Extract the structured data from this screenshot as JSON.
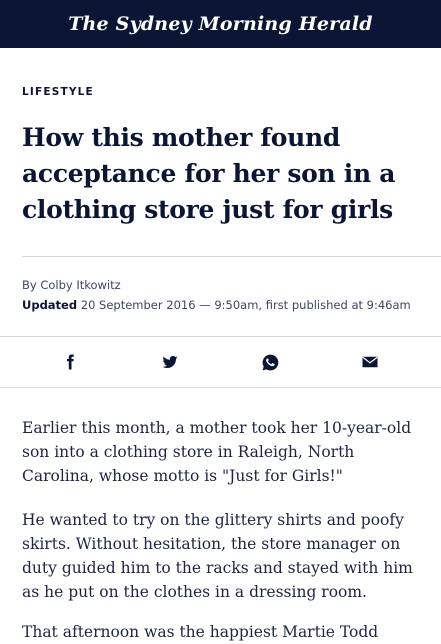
{
  "masthead": {
    "title": "The Sydney Morning Herald"
  },
  "article": {
    "section": "LIFESTYLE",
    "headline": "How this mother found acceptance for her son in a clothing store just for girls",
    "byline": "By Colby Itkowitz",
    "updated_label": "Updated",
    "updated_text": "20 September 2016 — 9:50am, first published at 9:46am",
    "paragraphs": [
      "Earlier this month, a mother took her 10-year-old son into a clothing store in Raleigh, North Carolina, whose motto is \"Just for Girls!\"",
      "He wanted to try on the glittery shirts and poofy skirts. Without hesitation, the store manager on duty guided him to the racks and stayed with him as he put on the clothes in a dressing room.",
      "That afternoon was the happiest Martie Todd"
    ]
  },
  "share": {
    "icons": [
      "facebook-icon",
      "twitter-icon",
      "whatsapp-icon",
      "email-icon"
    ]
  },
  "colors": {
    "brand_navy": "#0a1633",
    "rule": "#d6d9e0",
    "meta_text": "#3d4660"
  }
}
